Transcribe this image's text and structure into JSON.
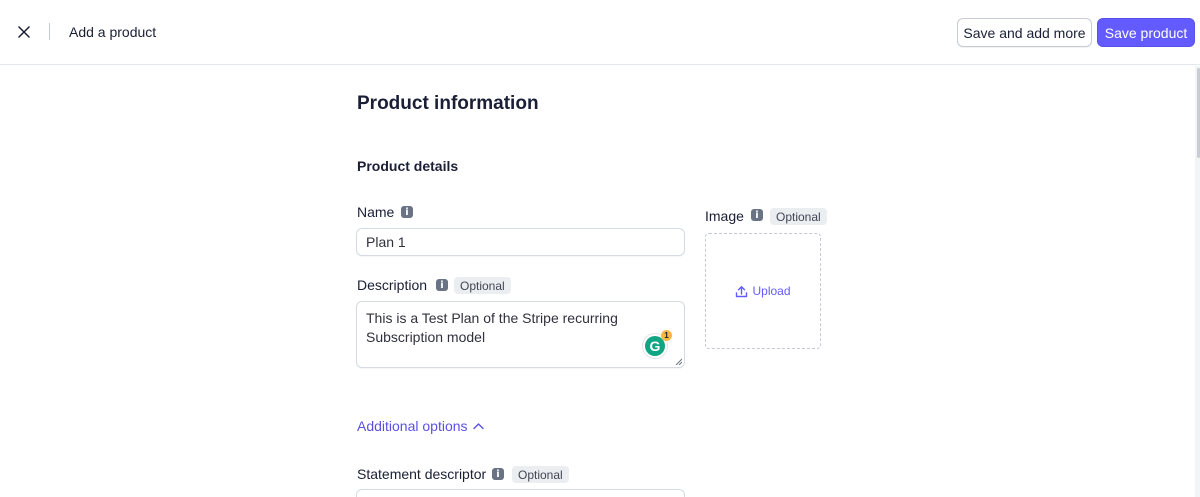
{
  "header": {
    "close_icon": "close-icon",
    "title": "Add a product",
    "save_add_more_label": "Save and add more",
    "save_product_label": "Save product",
    "primary_color": "#635bff"
  },
  "section": {
    "title": "Product information",
    "subtitle": "Product details"
  },
  "fields": {
    "name": {
      "label": "Name",
      "value": "Plan 1"
    },
    "description": {
      "label": "Description",
      "optional": "Optional",
      "value_line1": "This is a Test Plan of the Stripe recurring",
      "value_line2": "Subscription model",
      "grammarly_count": "1"
    },
    "image": {
      "label": "Image",
      "optional": "Optional",
      "upload_label": "Upload"
    },
    "statement_descriptor": {
      "label": "Statement descriptor",
      "optional": "Optional"
    }
  },
  "additional_options": {
    "label": "Additional options",
    "expanded": true
  }
}
